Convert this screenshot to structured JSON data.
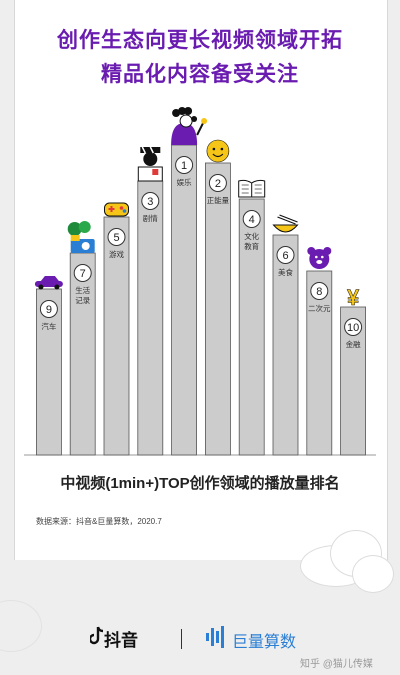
{
  "header": {
    "title_line1": "创作生态向更长视频领域开拓",
    "title_line2": "精品化内容备受关注"
  },
  "chart_data": {
    "type": "bar",
    "title": "中视频(1min+)TOP创作领域的播放量排名",
    "categories": [
      "汽车",
      "生活记录",
      "游戏",
      "剧情",
      "娱乐",
      "正能量",
      "文化教育",
      "美食",
      "二次元",
      "金融"
    ],
    "category_lines": [
      [
        "汽车"
      ],
      [
        "生活",
        "记录"
      ],
      [
        "游戏"
      ],
      [
        "剧情"
      ],
      [
        "娱乐"
      ],
      [
        "正能量"
      ],
      [
        "文化",
        "教育"
      ],
      [
        "美食"
      ],
      [
        "二次元"
      ],
      [
        "金融"
      ]
    ],
    "ranks": [
      9,
      7,
      5,
      3,
      1,
      2,
      4,
      6,
      8,
      10
    ],
    "values": [
      9,
      7,
      5,
      3,
      1,
      2,
      4,
      6,
      8,
      10
    ],
    "value_meaning": "rank (1 = highest play count)",
    "bar_color": "#cccccc",
    "icons": [
      "car-icon",
      "plant-camera-icon",
      "gamepad-icon",
      "film-director-icon",
      "singer-microphone-icon",
      "smiley-icon",
      "open-book-icon",
      "noodle-bowl-icon",
      "bear-face-icon",
      "yen-coin-icon"
    ]
  },
  "source_note": "数据来源：抖音&巨量算数，2020.7",
  "footer": {
    "brand_douyin": "抖音",
    "brand_juliang": "巨量算数",
    "watermark": "知乎 @猫儿传媒"
  },
  "colors": {
    "accent_purple": "#6a1bb0",
    "yellow": "#f5c518",
    "brand_blue": "#2a7fd4"
  }
}
